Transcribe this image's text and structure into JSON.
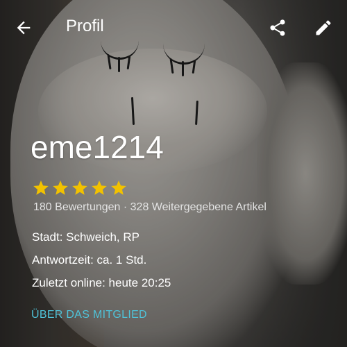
{
  "header": {
    "title": "Profil",
    "back_icon": "arrow-left-icon",
    "share_icon": "share-icon",
    "edit_icon": "pencil-icon"
  },
  "profile": {
    "username": "eme1214",
    "rating_stars": 5,
    "star_color": "#f2c200",
    "stats_text": "180 Bewertungen · 328 Weitergegebene Artikel",
    "city": "Stadt: Schweich, RP",
    "response_time": "Antwortzeit:  ca. 1 Std.",
    "last_online": "Zuletzt online: heute 20:25",
    "about_link": "ÜBER DAS MITGLIED",
    "accent_color": "#4fc3d9"
  }
}
